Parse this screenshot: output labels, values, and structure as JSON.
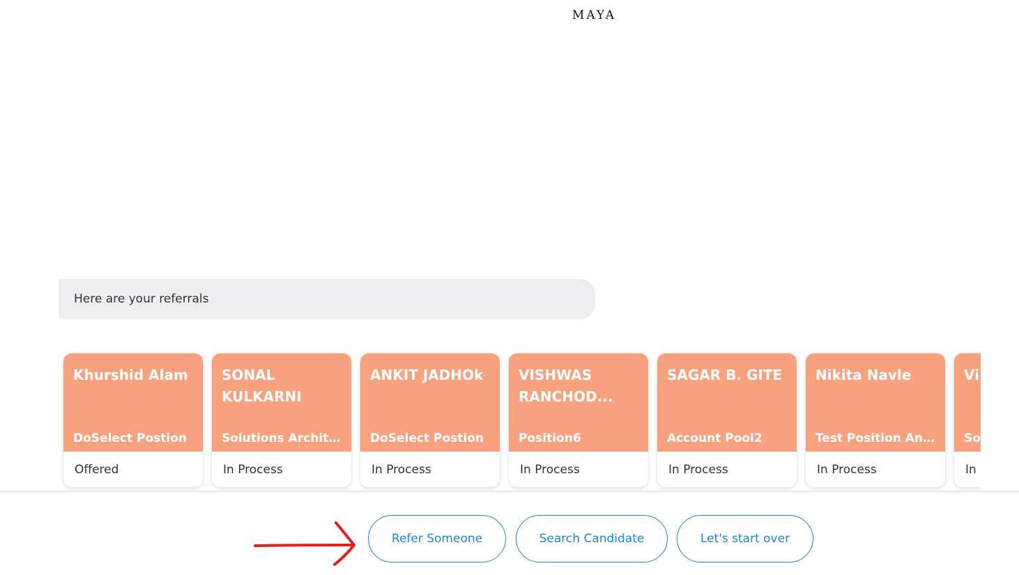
{
  "header": {
    "brand": "MAYA"
  },
  "chat": {
    "message": "Here are your referrals"
  },
  "referrals": [
    {
      "name": "Khurshid Alam",
      "position": "DoSelect Postion",
      "status": "Offered"
    },
    {
      "name": "SONAL KULKARNI",
      "position": "Solutions Architec...",
      "status": "In Process"
    },
    {
      "name": "ANKIT JADHOk",
      "position": "DoSelect Postion",
      "status": "In Process"
    },
    {
      "name": "VISHWAS RANCHOD...",
      "position": "Position6",
      "status": "In Process"
    },
    {
      "name": "SAGAR B. GITE",
      "position": "Account Pool2",
      "status": "In Process"
    },
    {
      "name": "Nikita Navle",
      "position": "Test Position Anni...",
      "status": "In Process"
    },
    {
      "name": "Vi",
      "position": "So",
      "status": "In"
    }
  ],
  "actions": {
    "refer": "Refer Someone",
    "search": "Search Candidate",
    "restart": "Let's start over"
  },
  "colors": {
    "card_accent": "#f8a17e",
    "button_blue": "#1a87d6",
    "annotation_arrow": "#e02020"
  },
  "annotation": {
    "icon": "red-arrow-right-icon"
  }
}
